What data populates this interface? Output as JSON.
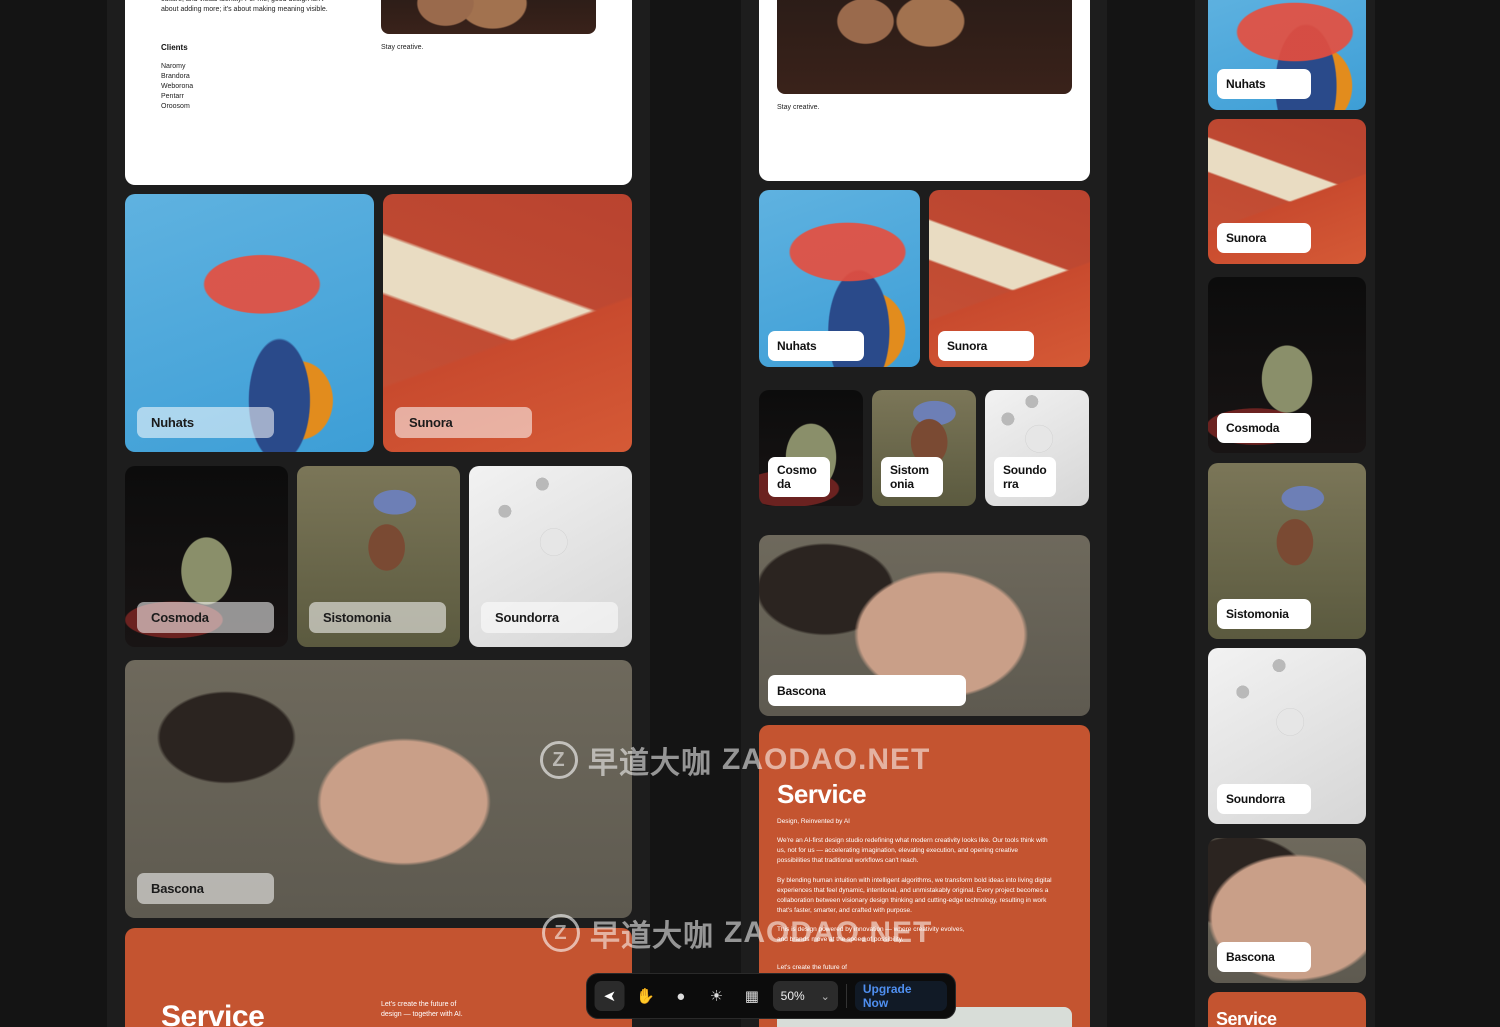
{
  "left": {
    "intro_text": "culture, and visual identity. For me, good design isn't about adding more; it's about making meaning visible.",
    "clients_heading": "Clients",
    "clients": [
      "Naromy",
      "Brandora",
      "Weborona",
      "Pentarr",
      "Oroosom"
    ],
    "stay_creative": "Stay creative.",
    "tiles": {
      "nuhats": "Nuhats",
      "sunora": "Sunora",
      "cosmoda": "Cosmoda",
      "sistomonia": "Sistomonia",
      "soundorra": "Soundorra",
      "bascona": "Bascona"
    },
    "service_title": "Service",
    "service_tagline": "Let's create the future of design — together with AI."
  },
  "middle": {
    "stay_creative": "Stay creative.",
    "tiles": {
      "nuhats": "Nuhats",
      "sunora": "Sunora",
      "cosmoda": "Cosmo da",
      "sistomonia": "Sistom onia",
      "soundorra": "Soundo rra",
      "bascona": "Bascona"
    },
    "service_title": "Service",
    "service_subtitle": "Design, Reinvented by AI",
    "service_p1": "We're an AI-first design studio redefining what modern creativity looks like. Our tools think with us, not for us — accelerating imagination, elevating execution, and opening creative possibilities that traditional workflows can't reach.",
    "service_p2": "By blending human intuition with intelligent algorithms, we transform bold ideas into living digital experiences that feel dynamic, intentional, and unmistakably original. Every project becomes a collaboration between visionary design thinking and cutting-edge technology, resulting in work that's faster, smarter, and crafted with purpose.",
    "service_p3": "This is design powered by innovation — where creativity evolves, and brands move at the speed of possibility.",
    "service_p4": "Let's create the future of"
  },
  "right": {
    "tiles": {
      "nuhats": "Nuhats",
      "sunora": "Sunora",
      "cosmoda": "Cosmoda",
      "sistomonia": "Sistomonia",
      "soundorra": "Soundorra",
      "bascona": "Bascona"
    },
    "service_title": "Service"
  },
  "watermark": {
    "text_cn": "早道大咖",
    "text_en": "ZAODAO.NET",
    "logo_letter": "Z"
  },
  "toolbar": {
    "tools": [
      {
        "icon": "pointer-icon",
        "glyph": "➤",
        "active": true
      },
      {
        "icon": "hand-icon",
        "glyph": "✋",
        "active": false
      },
      {
        "icon": "comment-icon",
        "glyph": "●",
        "active": false
      },
      {
        "icon": "sun-icon",
        "glyph": "☀",
        "active": false
      },
      {
        "icon": "grid-icon",
        "glyph": "▦",
        "active": false
      }
    ],
    "zoom": "50%",
    "zoom_caret": "⌄",
    "upgrade_label": "Upgrade Now"
  }
}
